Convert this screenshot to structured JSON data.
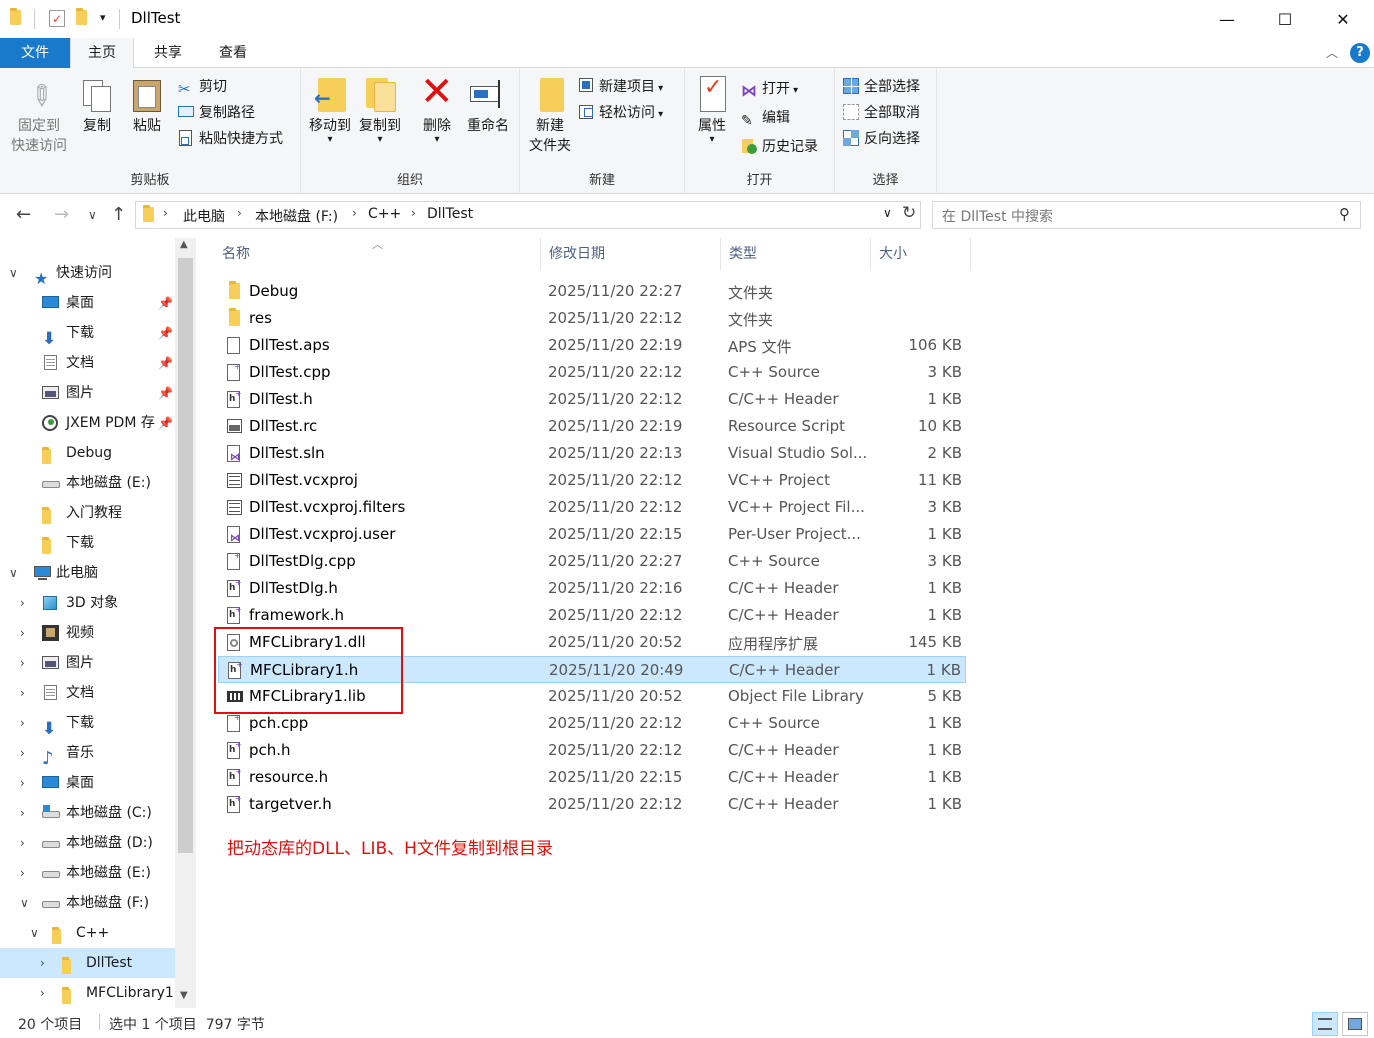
{
  "window": {
    "title": "DllTest"
  },
  "tabs": {
    "file": "文件",
    "home": "主页",
    "share": "共享",
    "view": "查看"
  },
  "ribbon": {
    "clipboard": {
      "label": "剪贴板",
      "pin_line1": "固定到",
      "pin_line2": "快速访问",
      "copy": "复制",
      "paste": "粘贴",
      "cut": "剪切",
      "copy_path": "复制路径",
      "paste_shortcut": "粘贴快捷方式"
    },
    "organize": {
      "label": "组织",
      "move_to": "移动到",
      "copy_to": "复制到",
      "delete": "删除",
      "rename": "重命名"
    },
    "new": {
      "label": "新建",
      "new_folder_line1": "新建",
      "new_folder_line2": "文件夹",
      "new_item": "新建项目",
      "easy_access": "轻松访问"
    },
    "open": {
      "label": "打开",
      "properties": "属性",
      "open": "打开",
      "edit": "编辑",
      "history": "历史记录"
    },
    "select": {
      "label": "选择",
      "select_all": "全部选择",
      "select_none": "全部取消",
      "invert": "反向选择"
    }
  },
  "address": {
    "crumbs": [
      "此电脑",
      "本地磁盘 (F:)",
      "C++",
      "DllTest"
    ],
    "search_placeholder": "在 DllTest 中搜索"
  },
  "nav": {
    "quick_access": "快速访问",
    "qa_items": [
      "桌面",
      "下载",
      "文档",
      "图片",
      "JXEM PDM 存",
      "Debug",
      "本地磁盘 (E:)",
      "入门教程",
      "下载"
    ],
    "this_pc": "此电脑",
    "pc_items": [
      "3D 对象",
      "视频",
      "图片",
      "文档",
      "下载",
      "音乐",
      "桌面",
      "本地磁盘 (C:)",
      "本地磁盘 (D:)",
      "本地磁盘 (E:)",
      "本地磁盘 (F:)"
    ],
    "sub_items": [
      "C++",
      "DllTest",
      "MFCLibrary1"
    ]
  },
  "columns": {
    "name": "名称",
    "date": "修改日期",
    "type": "类型",
    "size": "大小"
  },
  "files": [
    {
      "name": "Debug",
      "date": "2025/11/20 22:27",
      "type": "文件夹",
      "size": "",
      "icon": "folder"
    },
    {
      "name": "res",
      "date": "2025/11/20 22:12",
      "type": "文件夹",
      "size": "",
      "icon": "folder"
    },
    {
      "name": "DllTest.aps",
      "date": "2025/11/20 22:19",
      "type": "APS 文件",
      "size": "106 KB",
      "icon": "blank"
    },
    {
      "name": "DllTest.cpp",
      "date": "2025/11/20 22:12",
      "type": "C++ Source",
      "size": "3 KB",
      "icon": "cpp"
    },
    {
      "name": "DllTest.h",
      "date": "2025/11/20 22:12",
      "type": "C/C++ Header",
      "size": "1 KB",
      "icon": "h"
    },
    {
      "name": "DllTest.rc",
      "date": "2025/11/20 22:19",
      "type": "Resource Script",
      "size": "10 KB",
      "icon": "rc"
    },
    {
      "name": "DllTest.sln",
      "date": "2025/11/20 22:13",
      "type": "Visual Studio Sol...",
      "size": "2 KB",
      "icon": "sln"
    },
    {
      "name": "DllTest.vcxproj",
      "date": "2025/11/20 22:12",
      "type": "VC++ Project",
      "size": "11 KB",
      "icon": "proj"
    },
    {
      "name": "DllTest.vcxproj.filters",
      "date": "2025/11/20 22:12",
      "type": "VC++ Project Fil...",
      "size": "3 KB",
      "icon": "proj"
    },
    {
      "name": "DllTest.vcxproj.user",
      "date": "2025/11/20 22:15",
      "type": "Per-User Project...",
      "size": "1 KB",
      "icon": "sln"
    },
    {
      "name": "DllTestDlg.cpp",
      "date": "2025/11/20 22:27",
      "type": "C++ Source",
      "size": "3 KB",
      "icon": "cpp"
    },
    {
      "name": "DllTestDlg.h",
      "date": "2025/11/20 22:16",
      "type": "C/C++ Header",
      "size": "1 KB",
      "icon": "h"
    },
    {
      "name": "framework.h",
      "date": "2025/11/20 22:12",
      "type": "C/C++ Header",
      "size": "1 KB",
      "icon": "h"
    },
    {
      "name": "MFCLibrary1.dll",
      "date": "2025/11/20 20:52",
      "type": "应用程序扩展",
      "size": "145 KB",
      "icon": "dll"
    },
    {
      "name": "MFCLibrary1.h",
      "date": "2025/11/20 20:49",
      "type": "C/C++ Header",
      "size": "1 KB",
      "icon": "h",
      "selected": true
    },
    {
      "name": "MFCLibrary1.lib",
      "date": "2025/11/20 20:52",
      "type": "Object File Library",
      "size": "5 KB",
      "icon": "lib"
    },
    {
      "name": "pch.cpp",
      "date": "2025/11/20 22:12",
      "type": "C++ Source",
      "size": "1 KB",
      "icon": "cpp"
    },
    {
      "name": "pch.h",
      "date": "2025/11/20 22:12",
      "type": "C/C++ Header",
      "size": "1 KB",
      "icon": "h"
    },
    {
      "name": "resource.h",
      "date": "2025/11/20 22:15",
      "type": "C/C++ Header",
      "size": "1 KB",
      "icon": "h"
    },
    {
      "name": "targetver.h",
      "date": "2025/11/20 22:12",
      "type": "C/C++ Header",
      "size": "1 KB",
      "icon": "h"
    }
  ],
  "annotation": "把动态库的DLL、LIB、H文件复制到根目录",
  "status": {
    "count": "20 个项目",
    "selected": "选中 1 个项目  797 字节"
  },
  "colors": {
    "accent": "#1979ca",
    "selection": "#cce8ff",
    "annotation_red": "#e01010"
  }
}
